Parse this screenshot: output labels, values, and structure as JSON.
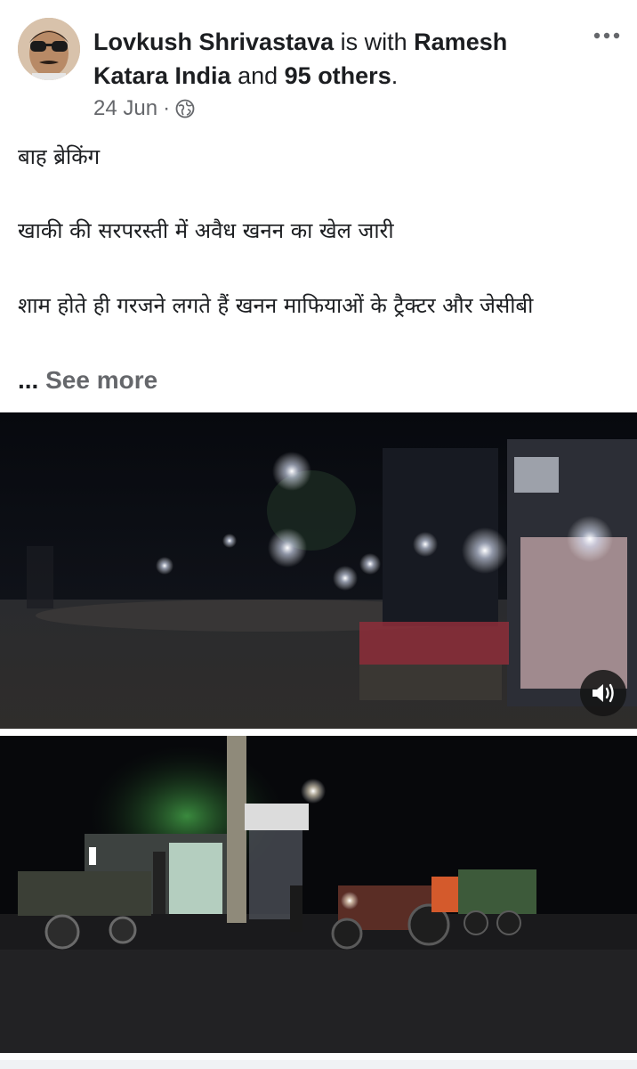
{
  "post": {
    "author": "Lovkush Shrivastava",
    "with_word": "is with",
    "tagged": "Ramesh Katara India",
    "and_word": "and",
    "others": "95 others",
    "period": ".",
    "date": "24 Jun",
    "separator": "·",
    "audience_icon": "globe-icon",
    "more_icon": "more-options-icon",
    "lines": [
      "बाह ब्रेकिंग",
      "खाकी की सरपरस्ती में अवैध खनन का खेल जारी",
      "शाम होते ही गरजने लगते हैं खनन माफियाओं के ट्रैक्टर और जेसीबी"
    ],
    "ellipsis": "...",
    "see_more": "See more"
  },
  "media": {
    "video_control_icon": "volume-icon"
  },
  "colors": {
    "text": "#1c1e21",
    "secondary_text": "#65676b",
    "background": "#ffffff"
  }
}
